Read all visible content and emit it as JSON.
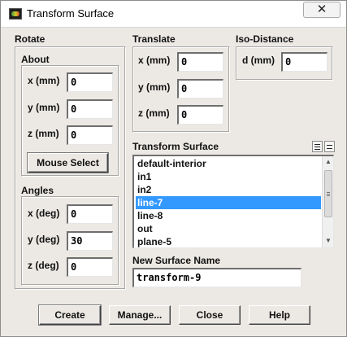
{
  "window": {
    "title": "Transform Surface",
    "close_label": "✕"
  },
  "rotate": {
    "label": "Rotate",
    "about": {
      "label": "About",
      "x_label": "x (mm)",
      "x_value": "0",
      "y_label": "y (mm)",
      "y_value": "0",
      "z_label": "z (mm)",
      "z_value": "0",
      "mouse_select_label": "Mouse Select"
    },
    "angles": {
      "label": "Angles",
      "x_label": "x (deg)",
      "x_value": "0",
      "y_label": "y (deg)",
      "y_value": "30",
      "z_label": "z (deg)",
      "z_value": "0"
    }
  },
  "translate": {
    "label": "Translate",
    "x_label": "x (mm)",
    "x_value": "0",
    "y_label": "y (mm)",
    "y_value": "0",
    "z_label": "z (mm)",
    "z_value": "0"
  },
  "iso_distance": {
    "label": "Iso-Distance",
    "d_label": "d (mm)",
    "d_value": "0"
  },
  "transform_surface": {
    "label": "Transform Surface",
    "items": [
      {
        "label": "default-interior",
        "selected": false
      },
      {
        "label": "in1",
        "selected": false
      },
      {
        "label": "in2",
        "selected": false
      },
      {
        "label": "line-7",
        "selected": true
      },
      {
        "label": "line-8",
        "selected": false
      },
      {
        "label": "out",
        "selected": false
      },
      {
        "label": "plane-5",
        "selected": false
      }
    ]
  },
  "new_surface": {
    "label": "New Surface Name",
    "value": "transform-9"
  },
  "buttons": {
    "create": "Create",
    "manage": "Manage...",
    "close": "Close",
    "help": "Help"
  },
  "colors": {
    "selection": "#3399ff",
    "dialog_background": "#ece9e4"
  }
}
